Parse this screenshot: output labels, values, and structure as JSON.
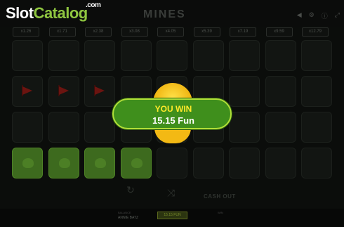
{
  "brand": {
    "part1": "Slot",
    "part2": "Catalog",
    "suffix": ".com"
  },
  "game": {
    "title": "MINES"
  },
  "multipliers": [
    "x1.26",
    "x1.71",
    "x2.38",
    "x3.08",
    "x4.05",
    "x5.39",
    "x7.19",
    "x9.59",
    "x12.79"
  ],
  "win": {
    "title": "YOU WIN",
    "amount": "15.15 Fun"
  },
  "controls": {
    "cashout_label": "CASH OUT"
  },
  "bottom": {
    "balance_label": "BALANCE",
    "balance_value": "ANNIE BATZ",
    "bet_value": "15.15 FUN",
    "win_label": "WIN"
  },
  "colors": {
    "win_panel": "#3f8f1c",
    "win_title": "#ffea2a",
    "coin": "#f0b410",
    "revealed_cell": "#3d6a1e",
    "brand_accent": "#8fc640"
  }
}
